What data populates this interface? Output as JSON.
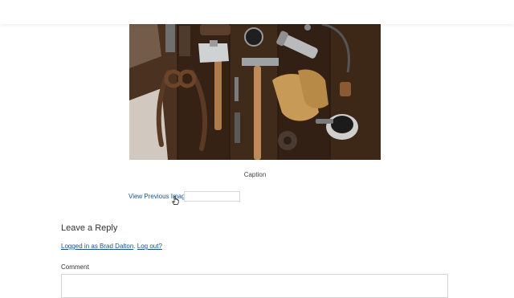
{
  "photo": {
    "alt": "Tools on wooden workbench"
  },
  "caption": "Caption",
  "navigation": {
    "previous_label": "View Previous Image",
    "next_label": ""
  },
  "reply": {
    "title": "Leave a Reply",
    "logged_in_text": "Logged in as Brad Dalton",
    "separator": ". ",
    "logout_text": "Log out?",
    "comment_label": "Comment",
    "comment_value": ""
  },
  "icons": {
    "cursor": "hand-pointer-icon"
  }
}
